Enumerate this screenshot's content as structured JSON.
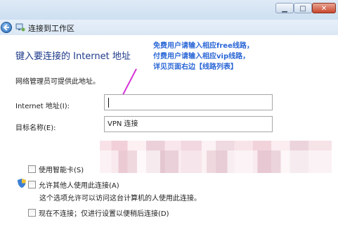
{
  "titlebar": {
    "min_glyph": "▁",
    "max_glyph": "□",
    "close_glyph": "✕"
  },
  "nav": {
    "title": "连接到工作区"
  },
  "heading": "键入要连接的 Internet 地址",
  "annotation": [
    "免费用户请输入相应free线路，",
    "付费用户请输入相应vip线路，",
    "详见页面右边【线路列表】"
  ],
  "info": "网络管理员可提供此地址。",
  "fields": {
    "address_label": "Internet 地址(I):",
    "address_value": "",
    "name_label": "目标名称(E):",
    "name_value": "VPN 连接"
  },
  "options": {
    "smartcard": "使用智能卡(S)",
    "allow_others": "允许其他人使用此连接(A)",
    "allow_note": "这个选项允许可以访问这台计算机的人使用此连接。",
    "dont_connect": "现在不连接；仅进行设置以便稍后连接(D)"
  },
  "colors": {
    "annotation": "#2a66d6",
    "arrow": "#d633d6",
    "heading": "#1e3a8a"
  }
}
